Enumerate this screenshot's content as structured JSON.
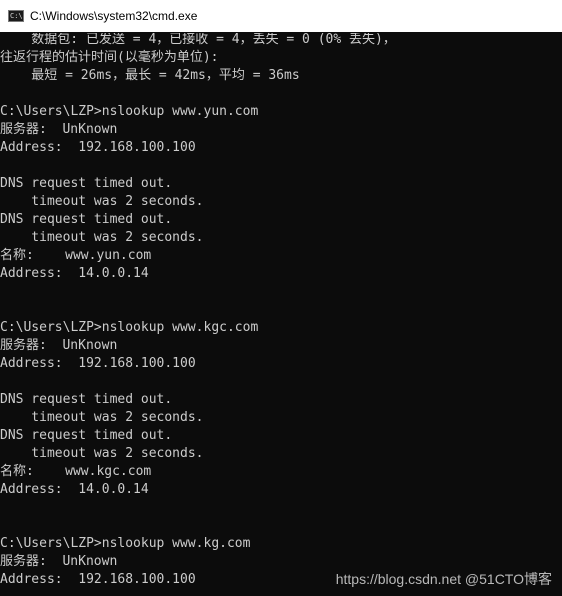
{
  "window": {
    "title": "C:\\Windows\\system32\\cmd.exe",
    "icon": "cmd-console-icon",
    "icon_text": "C:\\"
  },
  "console": {
    "lines": [
      "    数据包: 已发送 = 4，已接收 = 4，丢失 = 0 (0% 丢失)，",
      "往返行程的估计时间(以毫秒为单位):",
      "    最短 = 26ms，最长 = 42ms，平均 = 36ms",
      "",
      "C:\\Users\\LZP>nslookup www.yun.com",
      "服务器:  UnKnown",
      "Address:  192.168.100.100",
      "",
      "DNS request timed out.",
      "    timeout was 2 seconds.",
      "DNS request timed out.",
      "    timeout was 2 seconds.",
      "名称:    www.yun.com",
      "Address:  14.0.0.14",
      "",
      "",
      "C:\\Users\\LZP>nslookup www.kgc.com",
      "服务器:  UnKnown",
      "Address:  192.168.100.100",
      "",
      "DNS request timed out.",
      "    timeout was 2 seconds.",
      "DNS request timed out.",
      "    timeout was 2 seconds.",
      "名称:    www.kgc.com",
      "Address:  14.0.0.14",
      "",
      "",
      "C:\\Users\\LZP>nslookup www.kg.com",
      "服务器:  UnKnown",
      "Address:  192.168.100.100"
    ]
  },
  "watermark": {
    "text": "https://blog.csdn.net @51CTO博客"
  }
}
